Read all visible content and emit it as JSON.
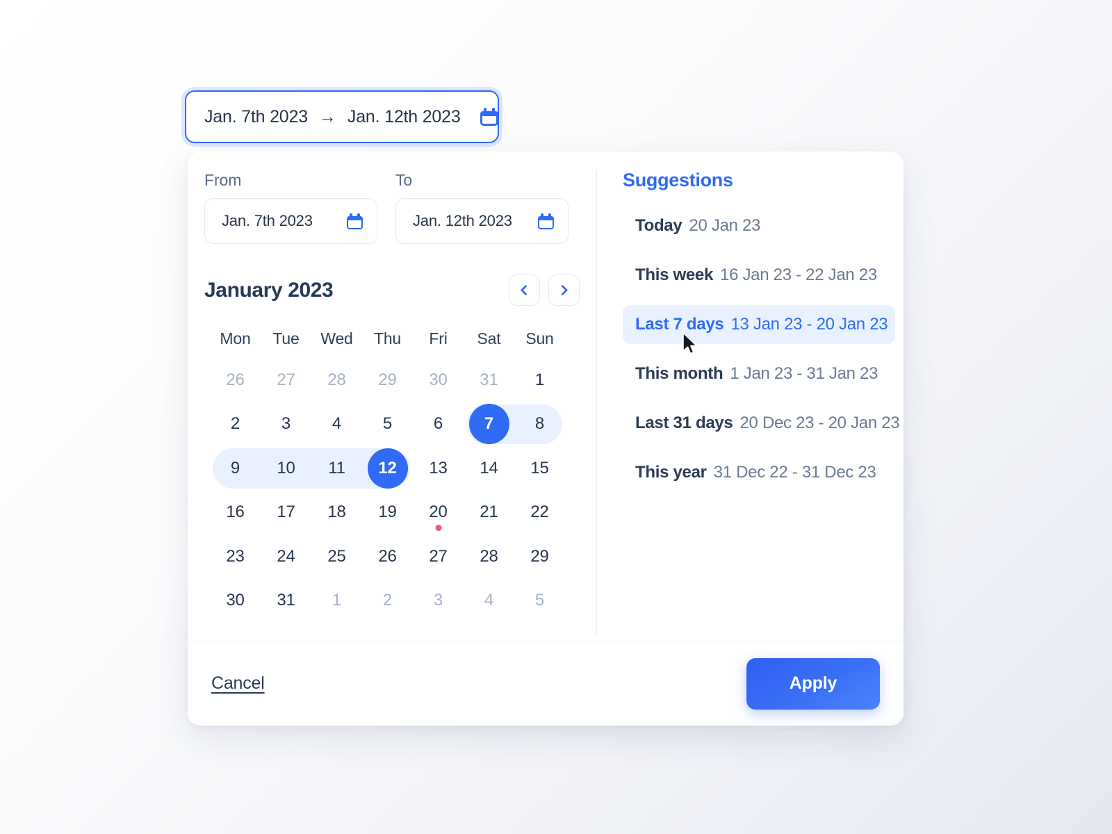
{
  "trigger": {
    "start": "Jan. 7th 2023",
    "arrow": "→",
    "end": "Jan. 12th 2023",
    "icon": "calendar-icon"
  },
  "fields": {
    "from_label": "From",
    "from_value": "Jan. 7th 2023",
    "to_label": "To",
    "to_value": "Jan. 12th 2023"
  },
  "calendar": {
    "month_title": "January 2023",
    "prev_icon": "chevron-left-icon",
    "next_icon": "chevron-right-icon",
    "weekdays": [
      "Mon",
      "Tue",
      "Wed",
      "Thu",
      "Fri",
      "Sat",
      "Sun"
    ],
    "weeks": [
      [
        {
          "d": "26",
          "muted": true
        },
        {
          "d": "27",
          "muted": true
        },
        {
          "d": "28",
          "muted": true
        },
        {
          "d": "29",
          "muted": true
        },
        {
          "d": "30",
          "muted": true
        },
        {
          "d": "31",
          "muted": true
        },
        {
          "d": "1"
        }
      ],
      [
        {
          "d": "2"
        },
        {
          "d": "3"
        },
        {
          "d": "4"
        },
        {
          "d": "5"
        },
        {
          "d": "6"
        },
        {
          "d": "7",
          "selected": true,
          "range": "start"
        },
        {
          "d": "8",
          "range": "end"
        }
      ],
      [
        {
          "d": "9",
          "range": "start"
        },
        {
          "d": "10",
          "range": "mid"
        },
        {
          "d": "11",
          "range": "mid"
        },
        {
          "d": "12",
          "selected": true,
          "range": "end"
        },
        {
          "d": "13"
        },
        {
          "d": "14"
        },
        {
          "d": "15"
        }
      ],
      [
        {
          "d": "16"
        },
        {
          "d": "17"
        },
        {
          "d": "18"
        },
        {
          "d": "19"
        },
        {
          "d": "20",
          "today": true
        },
        {
          "d": "21"
        },
        {
          "d": "22"
        }
      ],
      [
        {
          "d": "23"
        },
        {
          "d": "24"
        },
        {
          "d": "25"
        },
        {
          "d": "26"
        },
        {
          "d": "27"
        },
        {
          "d": "28"
        },
        {
          "d": "29"
        }
      ],
      [
        {
          "d": "30"
        },
        {
          "d": "31"
        },
        {
          "d": "1",
          "muted": true
        },
        {
          "d": "2",
          "muted": true
        },
        {
          "d": "3",
          "muted": true
        },
        {
          "d": "4",
          "muted": true
        },
        {
          "d": "5",
          "muted": true
        }
      ]
    ]
  },
  "suggestions": {
    "title": "Suggestions",
    "items": [
      {
        "label": "Today",
        "range": "20 Jan 23",
        "active": false
      },
      {
        "label": "This week",
        "range": "16 Jan 23 - 22 Jan 23",
        "active": false
      },
      {
        "label": "Last 7 days",
        "range": "13 Jan 23 - 20 Jan 23",
        "active": true
      },
      {
        "label": "This month",
        "range": "1 Jan 23 - 31 Jan 23",
        "active": false
      },
      {
        "label": "Last 31 days",
        "range": "20 Dec 23 - 20 Jan 23",
        "active": false
      },
      {
        "label": "This year",
        "range": "31 Dec 22 - 31 Dec 23",
        "active": false
      }
    ]
  },
  "footer": {
    "cancel_label": "Cancel",
    "apply_label": "Apply"
  },
  "colors": {
    "accent": "#2f6bf5",
    "range_bg": "#e9f1fe",
    "text": "#27354c",
    "muted_text": "#a8b2c4",
    "today_dot": "#f05a72"
  }
}
